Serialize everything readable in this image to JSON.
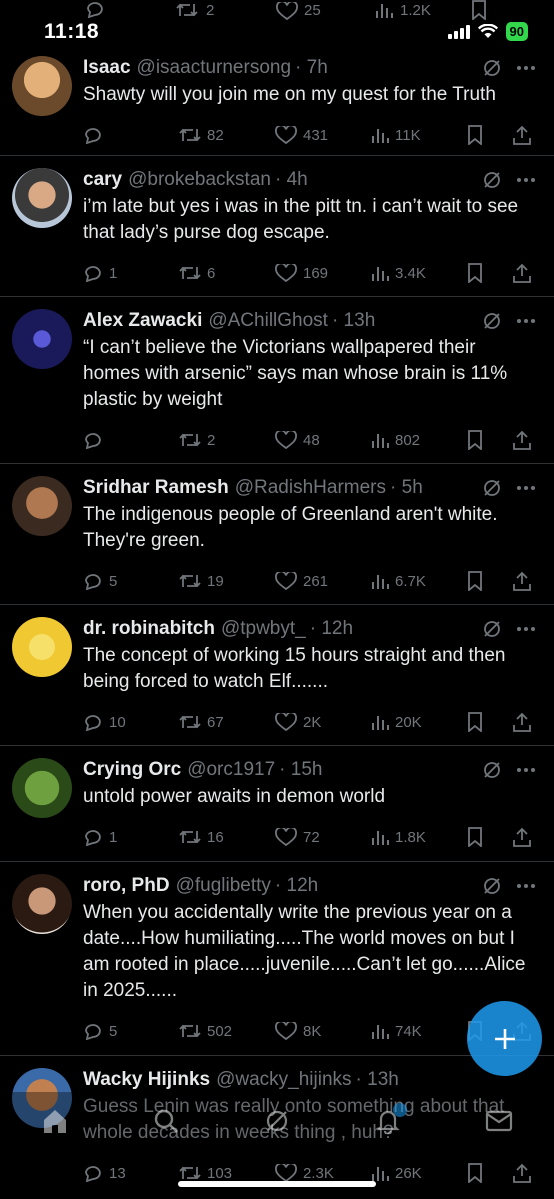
{
  "status": {
    "time": "11:18",
    "battery": "90"
  },
  "top_row": {
    "retweets": "2",
    "likes": "25",
    "views": "1.2K"
  },
  "tweets": [
    {
      "name": "Isaac",
      "handle": "@isaacturnersong",
      "time": "· 7h",
      "text": "Shawty will you join me on my quest for the Truth",
      "replies": "",
      "retweets": "82",
      "likes": "431",
      "views": "11K"
    },
    {
      "name": "cary",
      "handle": "@brokebackstan",
      "time": "· 4h",
      "text": "i’m late but yes i was in the pitt tn. i can’t wait to see that lady’s purse dog escape.",
      "replies": "1",
      "retweets": "6",
      "likes": "169",
      "views": "3.4K"
    },
    {
      "name": "Alex Zawacki",
      "handle": "@AChillGhost",
      "time": "· 13h",
      "text": "“I can’t believe the Victorians wallpapered their homes with arsenic” says man whose brain is 11% plastic by weight",
      "replies": "",
      "retweets": "2",
      "likes": "48",
      "views": "802"
    },
    {
      "name": "Sridhar Ramesh",
      "handle": "@RadishHarmers",
      "time": "· 5h",
      "text": "The indigenous people of Greenland aren't white. They're green.",
      "replies": "5",
      "retweets": "19",
      "likes": "261",
      "views": "6.7K"
    },
    {
      "name": "dr. robinabitch",
      "handle": "@tpwbyt_",
      "time": "· 12h",
      "text": "The concept of working 15 hours straight and then being forced to watch Elf.......",
      "replies": "10",
      "retweets": "67",
      "likes": "2K",
      "views": "20K"
    },
    {
      "name": "Crying Orc",
      "handle": "@orc1917",
      "time": "· 15h",
      "text": "untold power awaits in demon world",
      "replies": "1",
      "retweets": "16",
      "likes": "72",
      "views": "1.8K"
    },
    {
      "name": "roro, PhD",
      "handle": "@fuglibetty",
      "time": "· 12h",
      "text": "When you accidentally write the previous year on a date....How humiliating.....The world moves on but I am rooted in place.....juvenile.....Can’t let go......Alice in 2025......",
      "replies": "5",
      "retweets": "502",
      "likes": "8K",
      "views": "74K"
    },
    {
      "name": "Wacky Hijinks",
      "handle": "@wacky_hijinks",
      "time": "· 13h",
      "text": "Guess Lenin was really onto something about that whole decades in weeks thing , huh?",
      "replies": "13",
      "retweets": "103",
      "likes": "2.3K",
      "views": "26K"
    }
  ],
  "colors": {
    "background": "#000000",
    "text": "#e7e9ea",
    "muted": "#71767b",
    "accent": "#1d9bf0",
    "divider": "#2f3336"
  },
  "icons": [
    "reply-icon",
    "retweet-icon",
    "like-icon",
    "views-icon",
    "bookmark-icon",
    "share-icon",
    "grok-icon",
    "more-icon",
    "compose-icon",
    "home-icon",
    "search-icon",
    "grok-tab-icon",
    "bell-icon",
    "mail-icon"
  ]
}
